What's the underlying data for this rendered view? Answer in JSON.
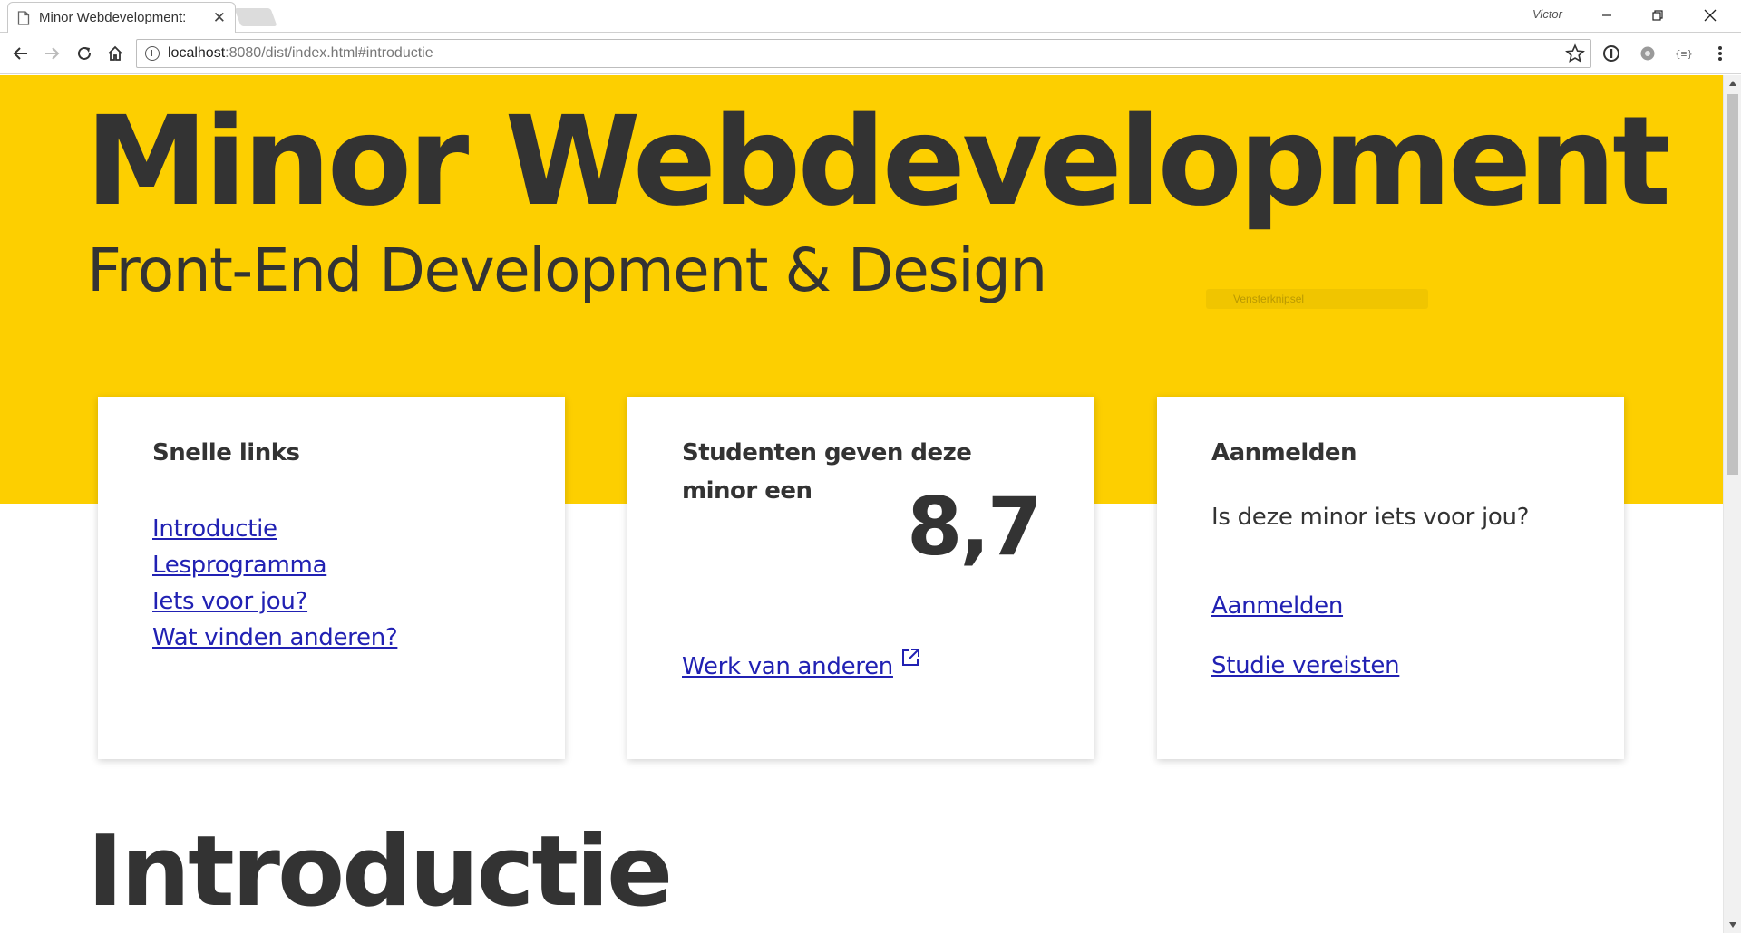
{
  "browser": {
    "tab_title": "Minor Webdevelopment:",
    "profile_name": "Victor",
    "url_host": "localhost",
    "url_rest": ":8080/dist/index.html#introductie",
    "icons": {
      "back": "back-arrow-icon",
      "forward": "forward-arrow-icon",
      "reload": "reload-icon",
      "home": "home-icon",
      "info": "info-icon",
      "star": "star-icon",
      "menu": "kebab-menu-icon"
    }
  },
  "overlay": {
    "snipping_label": "Vensterknipsel"
  },
  "hero": {
    "title": "Minor Webdevelopment",
    "subtitle": "Front-End Development & Design",
    "background_color": "#fdcf00"
  },
  "cards": {
    "quick_links": {
      "heading": "Snelle links",
      "links": [
        "Introductie",
        "Lesprogramma",
        "Iets voor jou?",
        "Wat vinden anderen?"
      ]
    },
    "rating": {
      "heading": "Studenten geven deze minor een",
      "score": "8,7",
      "link": "Werk van anderen"
    },
    "signup": {
      "heading": "Aanmelden",
      "text": "Is deze minor iets voor jou?",
      "link_signup": "Aanmelden",
      "link_requirements": "Studie vereisten"
    }
  },
  "section": {
    "title": "Introductie"
  },
  "colors": {
    "accent": "#fdcf00",
    "text": "#333333",
    "link": "#2121b3"
  }
}
